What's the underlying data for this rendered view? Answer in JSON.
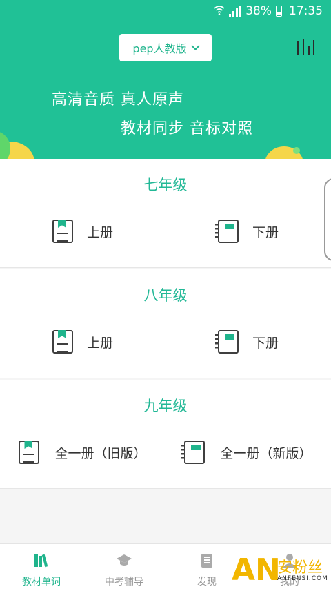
{
  "status_bar": {
    "battery": "38%",
    "time": "17:35"
  },
  "header": {
    "edition_label": "pep人教版",
    "slogan_line1": "高清音质 真人原声",
    "slogan_line2": "教材同步 音标对照"
  },
  "grades": [
    {
      "title": "七年级",
      "left_book": "上册",
      "right_book": "下册"
    },
    {
      "title": "八年级",
      "left_book": "上册",
      "right_book": "下册"
    },
    {
      "title": "九年级",
      "left_book": "全一册（旧版）",
      "right_book": "全一册（新版）"
    }
  ],
  "tabs": [
    {
      "label": "教材单词",
      "icon": "books-icon",
      "active": true
    },
    {
      "label": "中考辅导",
      "icon": "graduation-cap-icon",
      "active": false
    },
    {
      "label": "发现",
      "icon": "document-icon",
      "active": false
    },
    {
      "label": "我的",
      "icon": "person-icon",
      "active": false
    }
  ],
  "watermark": {
    "logo": "AN",
    "brand": "安粉丝",
    "domain": "ANFENSI.COM"
  },
  "colors": {
    "primary": "#20c196",
    "accent_text": "#22b896",
    "watermark": "#f2b600"
  }
}
